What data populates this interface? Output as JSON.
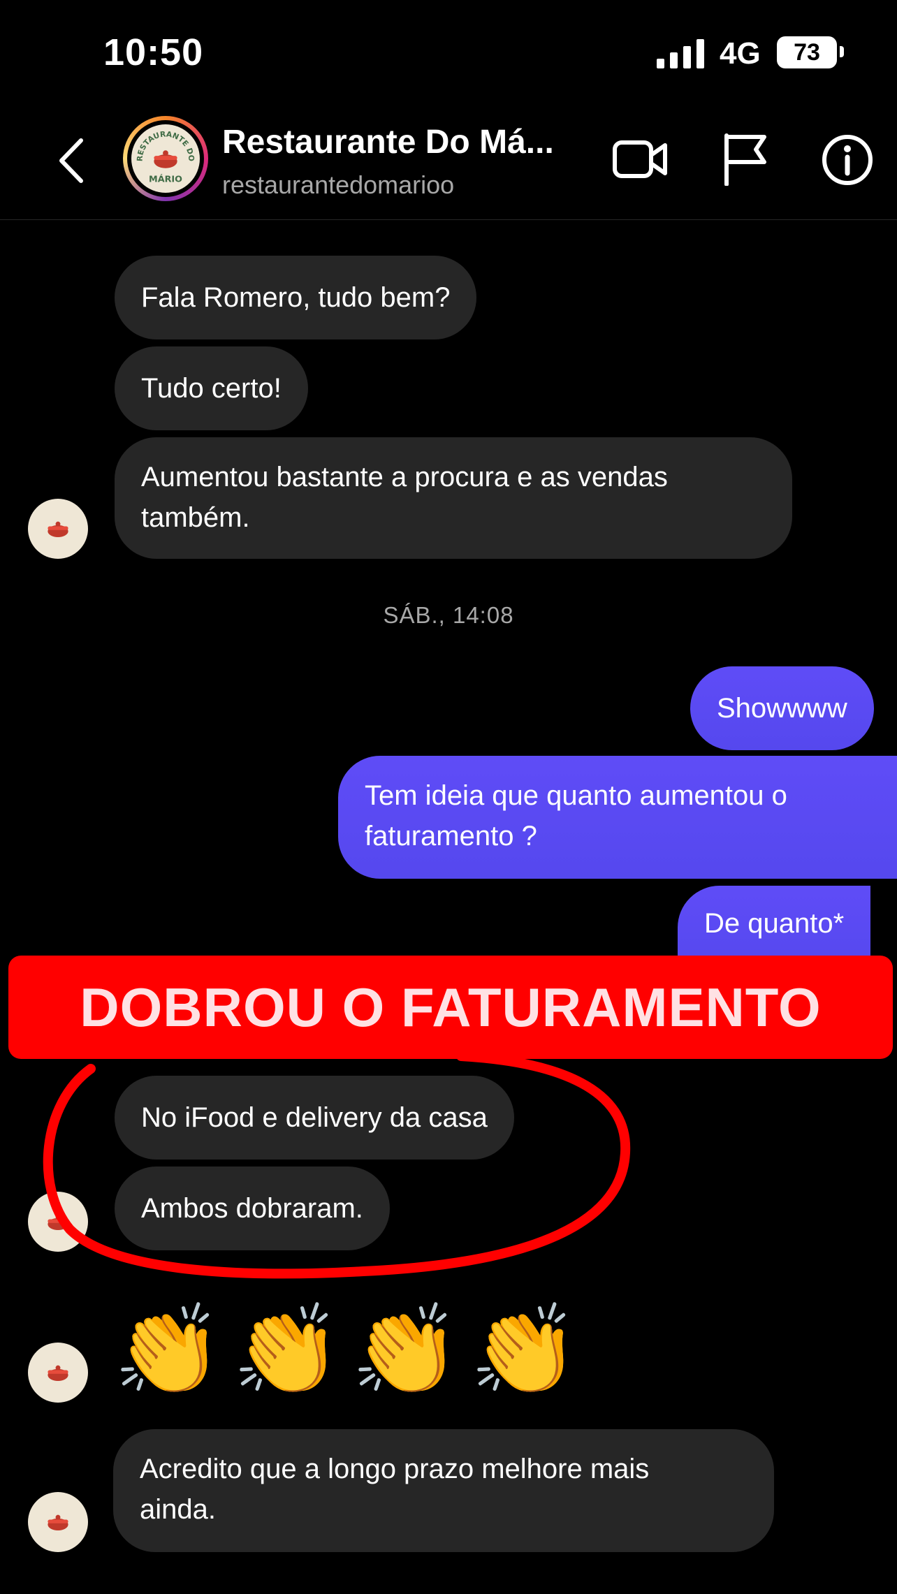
{
  "status_bar": {
    "time": "10:50",
    "network": "4G",
    "battery": "73"
  },
  "header": {
    "title": "Restaurante Do Má...",
    "username": "restaurantedomarioo"
  },
  "logo_text": {
    "top": "RESTAURANTE DO",
    "bottom": "MÁRIO"
  },
  "messages": [
    {
      "text": "Fala Romero, tudo bem?"
    },
    {
      "text": "Tudo certo!"
    },
    {
      "line1": "Aumentou bastante a procura e as vendas",
      "line2": "também."
    }
  ],
  "timestamp": "SÁB., 14:08",
  "sent": [
    {
      "text": "Showwww"
    },
    {
      "line1": "Tem ideia que quanto aumentou o",
      "line2": "faturamento ?"
    },
    {
      "text": "De quanto*"
    }
  ],
  "banner": "DOBROU O FATURAMENTO",
  "replies": [
    {
      "text": "No iFood e delivery da casa"
    },
    {
      "text": "Ambos dobraram."
    }
  ],
  "emoji": "👏",
  "final_message": {
    "line1": "Acredito que a longo prazo melhore mais",
    "line2": "ainda."
  },
  "colors": {
    "sent_bubble": "#5548ee",
    "received_bubble": "#262626",
    "banner": "#ff0000"
  }
}
